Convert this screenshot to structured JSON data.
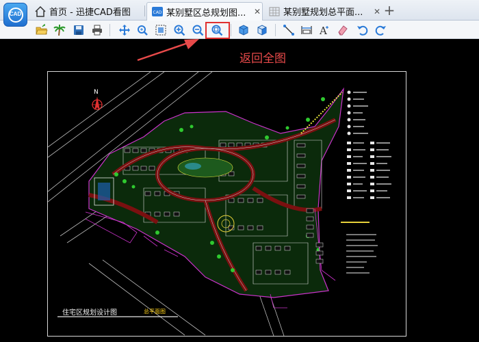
{
  "app": {
    "logo_text": "CAD"
  },
  "tabs": [
    {
      "label": "首页 - 迅捷CAD看图",
      "icon": "home-icon"
    },
    {
      "label": "某别墅区总规划图...",
      "icon": "cad-file-icon",
      "active": true
    },
    {
      "label": "某别墅规划总平面...",
      "icon": "grid-file-icon"
    }
  ],
  "toolbar": {
    "buttons": [
      "open-folder",
      "palm-tree",
      "save",
      "print",
      "pan",
      "zoom-window",
      "select-box",
      "zoom-in",
      "zoom-out",
      "zoom-extents",
      "3d-box",
      "3d-cube",
      "measure-line",
      "measure-dim",
      "text",
      "eraser",
      "undo",
      "redo"
    ]
  },
  "annotation": {
    "text": "返回全图",
    "color": "#e84a4a"
  },
  "drawing": {
    "north_label": "N",
    "title": "住宅区规划设计图",
    "subtitle": "总平面图"
  }
}
